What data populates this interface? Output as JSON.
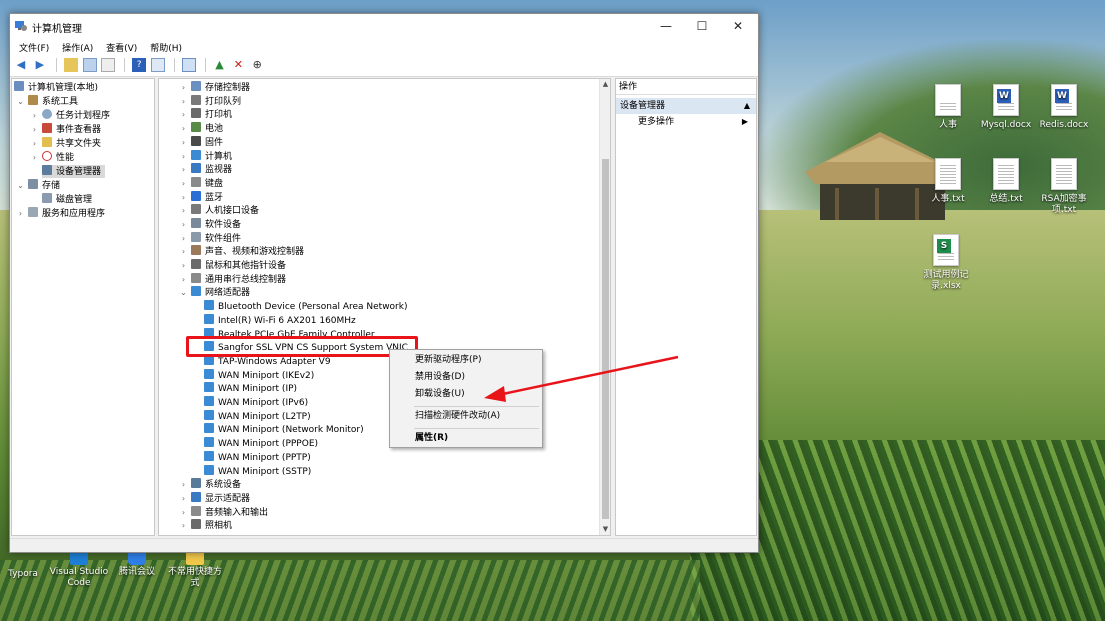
{
  "window": {
    "title": "计算机管理",
    "menu": [
      "文件(F)",
      "操作(A)",
      "查看(V)",
      "帮助(H)"
    ],
    "controls": {
      "minimize": "—",
      "maximize": "☐",
      "close": "✕"
    }
  },
  "left_tree": {
    "root": "计算机管理(本地)",
    "system_tools": "系统工具",
    "task_scheduler": "任务计划程序",
    "event_viewer": "事件查看器",
    "shared_folders": "共享文件夹",
    "performance": "性能",
    "device_manager": "设备管理器",
    "storage": "存储",
    "disk_management": "磁盘管理",
    "services_apps": "服务和应用程序"
  },
  "devices": {
    "categories_top": [
      "存储控制器",
      "打印队列",
      "打印机",
      "电池",
      "固件",
      "计算机",
      "监视器",
      "键盘",
      "蓝牙",
      "人机接口设备",
      "软件设备",
      "软件组件",
      "声音、视频和游戏控制器",
      "鼠标和其他指针设备",
      "通用串行总线控制器"
    ],
    "network_adapters": "网络适配器",
    "network_children": [
      "Bluetooth Device (Personal Area Network)",
      "Intel(R) Wi-Fi 6 AX201 160MHz",
      "Realtek PCIe GbE Family Controller",
      "Sangfor SSL VPN CS Support System VNIC",
      "TAP-Windows Adapter V9",
      "WAN Miniport (IKEv2)",
      "WAN Miniport (IP)",
      "WAN Miniport (IPv6)",
      "WAN Miniport (L2TP)",
      "WAN Miniport (Network Monitor)",
      "WAN Miniport (PPPOE)",
      "WAN Miniport (PPTP)",
      "WAN Miniport (SSTP)"
    ],
    "categories_bottom": [
      "系统设备",
      "显示适配器",
      "音频输入和输出",
      "照相机"
    ]
  },
  "actions": {
    "header": "操作",
    "section": "设备管理器",
    "more": "更多操作"
  },
  "context_menu": {
    "update_driver": "更新驱动程序(P)",
    "disable": "禁用设备(D)",
    "uninstall": "卸载设备(U)",
    "scan": "扫描检测硬件改动(A)",
    "properties": "属性(R)"
  },
  "desktop_icons": {
    "renshi": "人事",
    "mysql": "Mysql.docx",
    "redis": "Redis.docx",
    "renshi_txt": "人事.txt",
    "zongjie_txt": "总结.txt",
    "rsa_txt": "RSA加密事项.txt",
    "xlsx": "测试用例记录.xlsx",
    "typora": "Typora",
    "vscode": "Visual Studio Code",
    "tencent": "腾讯会议",
    "shortcut": "不常用快捷方式"
  },
  "colors": {
    "highlight_box": "#e8141a",
    "arrow": "#e8141a",
    "action_section_bg": "#dbe6f3"
  }
}
